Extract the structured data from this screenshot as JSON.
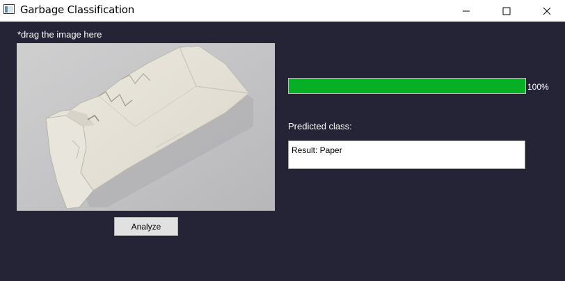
{
  "window": {
    "title": "Garbage Classification",
    "icon": "tk-window-icon",
    "controls": [
      "minimize-icon",
      "maximize-icon",
      "close-icon"
    ]
  },
  "main": {
    "drag_hint": "*drag the image here",
    "image": {
      "subject": "crumpled-white-envelope"
    },
    "analyze_label": "Analyze",
    "progress": {
      "value": 100,
      "label": "100%",
      "color": "#06b025"
    },
    "predicted_label": "Predicted class:",
    "result_text": "Result: Paper"
  },
  "colors": {
    "background": "#242436",
    "titlebar": "#ffffff",
    "text": "#ffffff"
  }
}
